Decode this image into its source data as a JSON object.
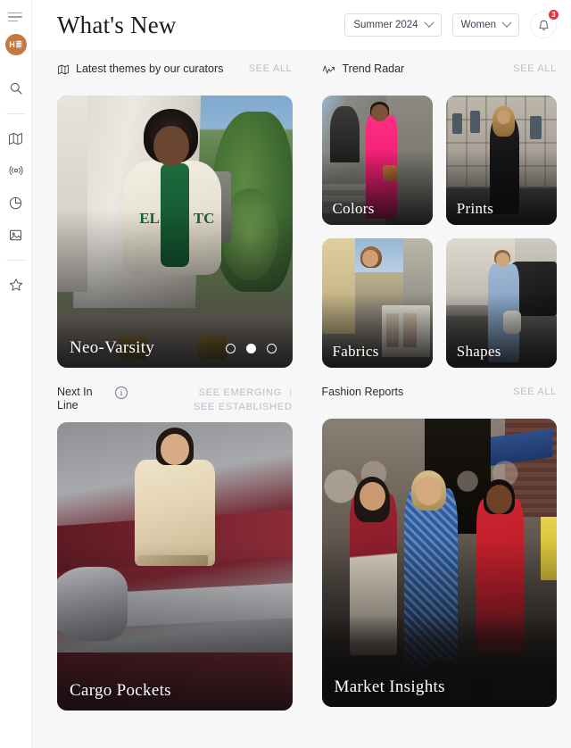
{
  "sidebar": {
    "menu_label": "menu",
    "avatar_initials": "H",
    "items": [
      {
        "name": "search",
        "label": "Search"
      },
      {
        "name": "map",
        "label": "Map"
      },
      {
        "name": "radar",
        "label": "Radar"
      },
      {
        "name": "analytics",
        "label": "Analytics"
      },
      {
        "name": "images",
        "label": "Images"
      },
      {
        "name": "favorites",
        "label": "Favorites"
      }
    ]
  },
  "header": {
    "title": "What's New",
    "season_select": "Summer 2024",
    "gender_select": "Women",
    "notification_count": "3"
  },
  "sections": {
    "themes": {
      "title": "Latest themes by our curators",
      "see_all": "SEE ALL",
      "hero": {
        "caption": "Neo-Varsity",
        "dots": 3,
        "active_dot": 1
      }
    },
    "trend_radar": {
      "title": "Trend Radar",
      "see_all": "SEE ALL",
      "cards": [
        {
          "caption": "Colors"
        },
        {
          "caption": "Prints"
        },
        {
          "caption": "Fabrics"
        },
        {
          "caption": "Shapes"
        }
      ]
    },
    "next_in_line": {
      "title": "Next In Line",
      "link_emerging": "SEE EMERGING",
      "divider": "|",
      "link_established": "SEE ESTABLISHED",
      "card": {
        "caption": "Cargo Pockets"
      }
    },
    "fashion_reports": {
      "title": "Fashion Reports",
      "see_all": "SEE ALL",
      "card": {
        "caption": "Market Insights"
      }
    }
  },
  "colors": {
    "accent": "#c5793f",
    "badge": "#e8333a",
    "page_bg": "#f7f7f7",
    "muted_link": "#b9bfc8"
  }
}
